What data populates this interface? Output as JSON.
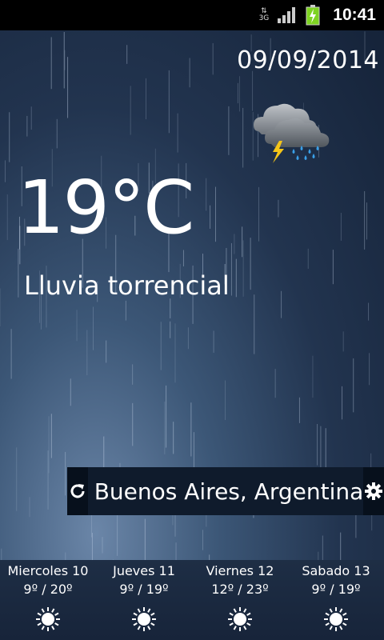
{
  "status_bar": {
    "network_label": "3G",
    "time": "10:41"
  },
  "weather": {
    "date": "09/09/2014",
    "temperature": "19°C",
    "condition": "Lluvia torrencial",
    "icon": "thunderstorm-rain-icon"
  },
  "location": {
    "name": "Buenos Aires, Argentina"
  },
  "forecast": [
    {
      "day": "Miercoles 10",
      "temps": "9º / 20º",
      "icon": "sun-icon"
    },
    {
      "day": "Jueves 11",
      "temps": "9º / 19º",
      "icon": "sun-icon"
    },
    {
      "day": "Viernes 12",
      "temps": "12º / 23º",
      "icon": "sun-icon"
    },
    {
      "day": "Sabado 13",
      "temps": "9º / 19º",
      "icon": "sun-icon"
    }
  ],
  "colors": {
    "status_bar_bg": "#000000",
    "background": "#22344f",
    "location_bar_bg": "#0f1b2c",
    "battery": "#7ed321",
    "bolt": "#f5c518",
    "raindrop": "#3aa0e8"
  }
}
